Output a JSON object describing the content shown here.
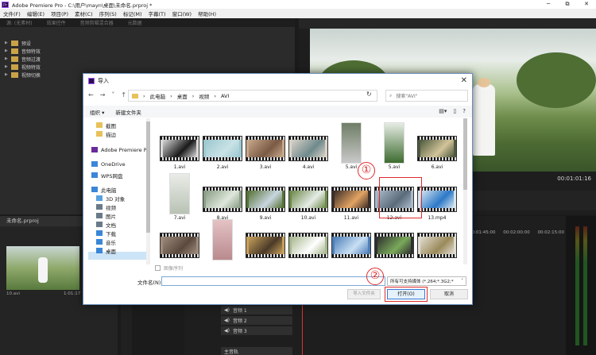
{
  "app": {
    "title": "Adobe Premiere Pro - C:\\用户\\mayn\\桌面\\未命名.prproj *",
    "icon": "premiere-icon",
    "window_controls": [
      "─",
      "⧉",
      "✕"
    ]
  },
  "menu": [
    "文件(F)",
    "编辑(E)",
    "项目(P)",
    "素材(C)",
    "序列(S)",
    "标记(M)",
    "字幕(T)",
    "窗口(W)",
    "帮助(H)"
  ],
  "effects_panel": {
    "tabs": [
      "源: (无素材)",
      "效果控件",
      "音频剪辑混合器",
      "元数据"
    ],
    "items": [
      "预设",
      "音频特效",
      "音频过渡",
      "视频特效",
      "视频切换"
    ]
  },
  "program_monitor": {
    "timecode": "00:01:01:16"
  },
  "project_panel": {
    "tab": "未命名.prproj",
    "clip_name": "10.avi",
    "clip_duration": "1:01:17"
  },
  "timeline": {
    "ruler": [
      "00:01:45:00",
      "00:02:00:00",
      "00:02:15:00"
    ],
    "tracks": [
      "音频 1",
      "音频 2",
      "音频 3",
      "主音轨"
    ]
  },
  "dialog": {
    "title": "导入",
    "breadcrumb": [
      "此电脑",
      "桌面",
      "视频",
      "AVI"
    ],
    "search_placeholder": "搜索\"AVI\"",
    "toolbar": {
      "organize": "组织 ▾",
      "new_folder": "新建文件夹"
    },
    "nav": [
      {
        "label": "截图",
        "icon": "folder-icon",
        "color": "#e8c15b"
      },
      {
        "label": "描边",
        "icon": "folder-icon",
        "color": "#e8c15b"
      },
      {
        "label": "Adobe Premiere P",
        "icon": "premiere-icon",
        "color": "#6a2a9a"
      },
      {
        "label": "OneDrive",
        "icon": "cloud-icon",
        "color": "#3b86d8"
      },
      {
        "label": "WPS网盘",
        "icon": "cloud-icon",
        "color": "#3b86d8"
      },
      {
        "label": "此电脑",
        "icon": "pc-icon",
        "color": "#3b86d8"
      },
      {
        "label": "3D 对象",
        "icon": "cube-icon",
        "color": "#58a0e0"
      },
      {
        "label": "视频",
        "icon": "video-icon",
        "color": "#6a7a8a"
      },
      {
        "label": "图片",
        "icon": "picture-icon",
        "color": "#6a7a8a"
      },
      {
        "label": "文档",
        "icon": "document-icon",
        "color": "#6a7a8a"
      },
      {
        "label": "下载",
        "icon": "download-icon",
        "color": "#3b86d8"
      },
      {
        "label": "音乐",
        "icon": "music-icon",
        "color": "#3b86d8"
      },
      {
        "label": "桌面",
        "icon": "desktop-icon",
        "color": "#3b86d8"
      }
    ],
    "files": [
      {
        "name": "1.avi",
        "bg": "#d9d9d9",
        "fg": "#1a1a1a"
      },
      {
        "name": "2.avi",
        "bg": "#9cc8cf",
        "fg": "#c9e2e6"
      },
      {
        "name": "3.avi",
        "bg": "#c6a78a",
        "fg": "#7a5a44"
      },
      {
        "name": "4.avi",
        "bg": "#d9d2c8",
        "fg": "#6f8a8c"
      },
      {
        "name": "5.avi",
        "bg": "#6f7d66",
        "fg": "#c9c9c9"
      },
      {
        "name": "5.avi",
        "bg": "#e6ece4",
        "fg": "#3d6b2f"
      },
      {
        "name": "6.avi",
        "bg": "#4d5a3e",
        "fg": "#d2c49a"
      },
      {
        "name": "7.avi",
        "bg": "#e9ece7",
        "fg": "#b9c2b4"
      },
      {
        "name": "8.avi",
        "bg": "#8a9e86",
        "fg": "#dfe7dc"
      },
      {
        "name": "9.avi",
        "bg": "#577338",
        "fg": "#c9d6e0"
      },
      {
        "name": "10.avi",
        "bg": "#6d8a4b",
        "fg": "#e6ece6"
      },
      {
        "name": "11.avi",
        "bg": "#3d2e28",
        "fg": "#e3a463"
      },
      {
        "name": "12.avi",
        "bg": "#aab9c8",
        "fg": "#5a6b7a"
      },
      {
        "name": "13.mp4",
        "bg": "#d7e6f0",
        "fg": "#2d79c7"
      },
      {
        "name": "",
        "bg": "#9e8b7c",
        "fg": "#5a4a3e"
      },
      {
        "name": "",
        "bg": "#e4c2c4",
        "fg": "#b98a8e"
      },
      {
        "name": "",
        "bg": "#c7a05c",
        "fg": "#4a3a28"
      },
      {
        "name": "",
        "bg": "#a8b88f",
        "fg": "#ffffff"
      },
      {
        "name": "",
        "bg": "#4e7fb8",
        "fg": "#c9e0f4"
      },
      {
        "name": "",
        "bg": "#2f2f2f",
        "fg": "#7aaa5a"
      },
      {
        "name": "",
        "bg": "#e2ddd2",
        "fg": "#9a8a5a"
      }
    ],
    "sequence_checkbox": "图像序列",
    "filename_label": "文件名(N):",
    "filename_value": "",
    "filetype": "所有可支持媒体 (*.264;*.3G2;*",
    "buttons": {
      "import_folder": "导入文件夹",
      "open": "打开(O)",
      "cancel": "取消"
    },
    "annotations": [
      "①",
      "②"
    ],
    "highlight_color": "#e02b2b"
  }
}
